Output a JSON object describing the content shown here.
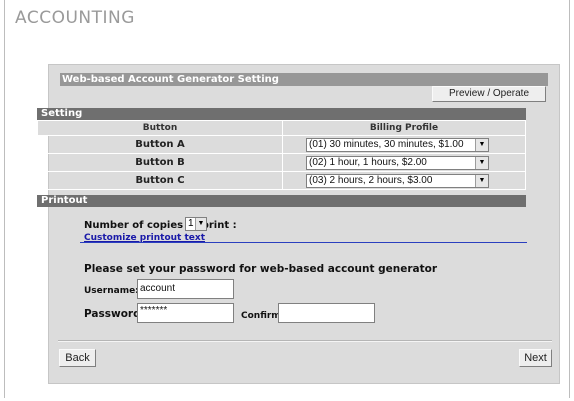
{
  "page": {
    "title": "ACCOUNTING"
  },
  "panel": {
    "header": "Web-based Account Generator Setting",
    "preview_label": "Preview / Operate"
  },
  "setting": {
    "header": "Setting",
    "columns": [
      "Button",
      "Billing Profile"
    ],
    "rows": [
      {
        "button": "Button A",
        "profile": "(01) 30 minutes, 30 minutes, $1.00"
      },
      {
        "button": "Button B",
        "profile": "(02) 1 hour, 1 hours, $2.00"
      },
      {
        "button": "Button C",
        "profile": "(03) 2 hours, 2 hours, $3.00"
      }
    ]
  },
  "printout": {
    "header": "Printout",
    "copies_label": "Number of copies to print :",
    "copies_value": "1",
    "customize_link": "Customize printout text"
  },
  "password": {
    "note": "Please set your password for web-based account generator",
    "username_label": "Username:",
    "username_value": "account",
    "password_label": "Password:",
    "password_value": "*******",
    "confirm_label": "Confirm:",
    "confirm_value": ""
  },
  "nav": {
    "back_label": "Back",
    "next_label": "Next"
  },
  "icons": {
    "dropdown": "chevron-down-icon"
  },
  "colors": {
    "panel_bg": "#dcdcdc",
    "section_head": "#6f6f6f",
    "panel_head": "#979797",
    "link": "#1a1aa8"
  }
}
